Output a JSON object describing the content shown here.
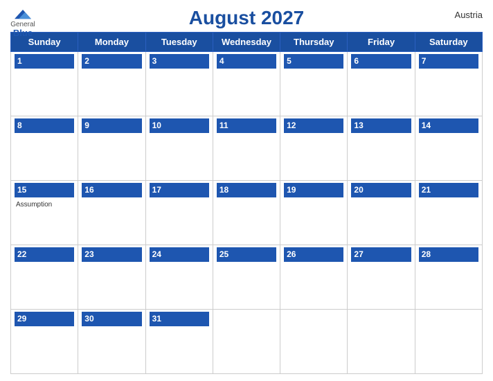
{
  "header": {
    "title": "August 2027",
    "country": "Austria",
    "logo": {
      "general": "General",
      "blue": "Blue"
    }
  },
  "colors": {
    "header_bg": "#1e56b0",
    "header_text": "#ffffff",
    "day_num_bg": "#1e56b0",
    "day_num_text": "#ffffff",
    "cell_bg": "#ffffff",
    "title_color": "#1e56b0"
  },
  "weekdays": [
    "Sunday",
    "Monday",
    "Tuesday",
    "Wednesday",
    "Thursday",
    "Friday",
    "Saturday"
  ],
  "weeks": [
    [
      {
        "day": "1",
        "events": []
      },
      {
        "day": "2",
        "events": []
      },
      {
        "day": "3",
        "events": []
      },
      {
        "day": "4",
        "events": []
      },
      {
        "day": "5",
        "events": []
      },
      {
        "day": "6",
        "events": []
      },
      {
        "day": "7",
        "events": []
      }
    ],
    [
      {
        "day": "8",
        "events": []
      },
      {
        "day": "9",
        "events": []
      },
      {
        "day": "10",
        "events": []
      },
      {
        "day": "11",
        "events": []
      },
      {
        "day": "12",
        "events": []
      },
      {
        "day": "13",
        "events": []
      },
      {
        "day": "14",
        "events": []
      }
    ],
    [
      {
        "day": "15",
        "events": [
          "Assumption"
        ]
      },
      {
        "day": "16",
        "events": []
      },
      {
        "day": "17",
        "events": []
      },
      {
        "day": "18",
        "events": []
      },
      {
        "day": "19",
        "events": []
      },
      {
        "day": "20",
        "events": []
      },
      {
        "day": "21",
        "events": []
      }
    ],
    [
      {
        "day": "22",
        "events": []
      },
      {
        "day": "23",
        "events": []
      },
      {
        "day": "24",
        "events": []
      },
      {
        "day": "25",
        "events": []
      },
      {
        "day": "26",
        "events": []
      },
      {
        "day": "27",
        "events": []
      },
      {
        "day": "28",
        "events": []
      }
    ],
    [
      {
        "day": "29",
        "events": []
      },
      {
        "day": "30",
        "events": []
      },
      {
        "day": "31",
        "events": []
      },
      {
        "day": "",
        "events": []
      },
      {
        "day": "",
        "events": []
      },
      {
        "day": "",
        "events": []
      },
      {
        "day": "",
        "events": []
      }
    ]
  ]
}
